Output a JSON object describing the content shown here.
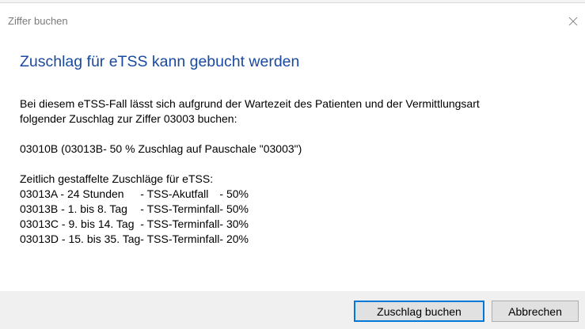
{
  "window": {
    "title": "Ziffer buchen",
    "close_icon": "close-icon"
  },
  "heading": "Zuschlag für eTSS kann gebucht werden",
  "intro": {
    "line1": "Bei diesem eTSS-Fall lässt sich aufgrund der Wartezeit des Patienten und der Vermittlungsart",
    "line2": "folgender Zuschlag zur Ziffer 03003 buchen:"
  },
  "selected_surcharge": "03010B  (03013B- 50 % Zuschlag auf Pauschale \"03003\")",
  "rates": {
    "title": "Zeitlich gestaffelte Zuschläge für eTSS:",
    "rows": [
      {
        "code": "03013A - 24 Stunden",
        "type": "- TSS-Akutfall",
        "percent": "- 50%"
      },
      {
        "code": "03013B - 1. bis 8. Tag",
        "type": "- TSS-Terminfall",
        "percent": "- 50%"
      },
      {
        "code": "03013C - 9. bis 14. Tag",
        "type": "- TSS-Terminfall",
        "percent": "- 30%"
      },
      {
        "code": "03013D - 15. bis 35. Tag",
        "type": "- TSS-Terminfall",
        "percent": "- 20%"
      }
    ]
  },
  "buttons": {
    "primary": "Zuschlag buchen",
    "secondary": "Abbrechen"
  },
  "colors": {
    "heading": "#1a4aa0",
    "footer": "#f0f0f0",
    "focus_border": "#0078d7"
  }
}
